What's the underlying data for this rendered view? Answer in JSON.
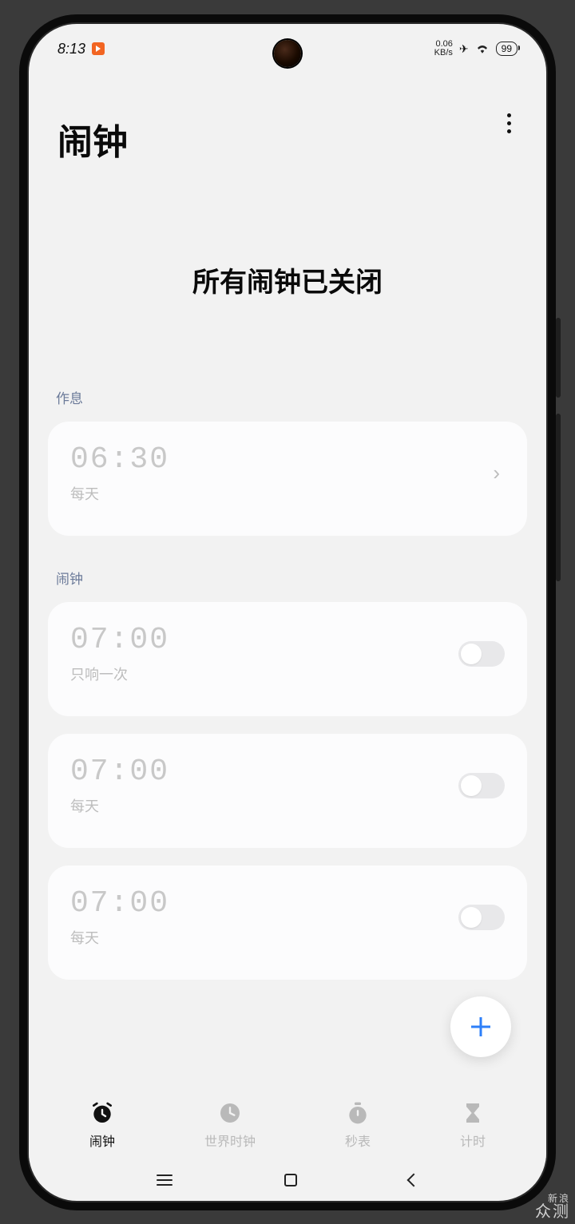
{
  "status": {
    "time": "8:13",
    "net_speed_top": "0.06",
    "net_speed_unit": "KB/s",
    "battery": "99"
  },
  "header": {
    "title": "闹钟"
  },
  "hero": {
    "message": "所有闹钟已关闭"
  },
  "sections": {
    "routine_label": "作息",
    "alarm_label": "闹钟"
  },
  "routine": {
    "time": "06:30",
    "repeat": "每天"
  },
  "alarms": [
    {
      "time": "07:00",
      "repeat": "只响一次",
      "enabled": false
    },
    {
      "time": "07:00",
      "repeat": "每天",
      "enabled": false
    },
    {
      "time": "07:00",
      "repeat": "每天",
      "enabled": false
    }
  ],
  "tabs": [
    {
      "id": "alarm",
      "label": "闹钟",
      "active": true
    },
    {
      "id": "world",
      "label": "世界时钟",
      "active": false
    },
    {
      "id": "stopwatch",
      "label": "秒表",
      "active": false
    },
    {
      "id": "timer",
      "label": "计时",
      "active": false
    }
  ],
  "watermark": {
    "brand": "新浪",
    "sub": "众测"
  }
}
